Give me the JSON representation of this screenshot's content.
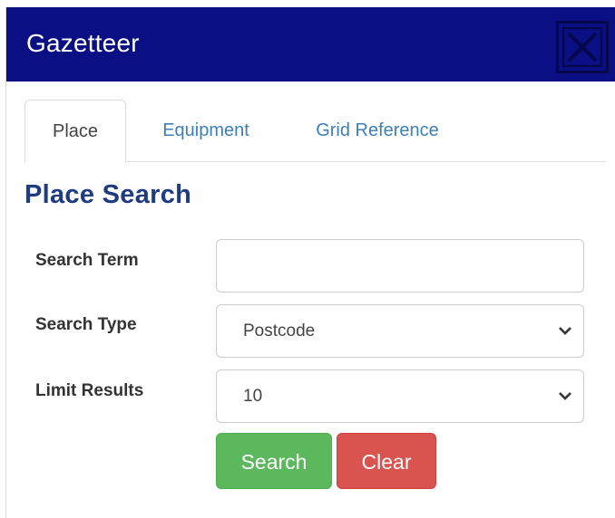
{
  "window": {
    "title": "Gazetteer",
    "close_icon": "close-icon"
  },
  "tabs": [
    {
      "label": "Place",
      "active": true
    },
    {
      "label": "Equipment",
      "active": false
    },
    {
      "label": "Grid Reference",
      "active": false
    }
  ],
  "form": {
    "heading": "Place Search",
    "search_term": {
      "label": "Search Term",
      "value": "",
      "placeholder": ""
    },
    "search_type": {
      "label": "Search Type",
      "selected": "Postcode"
    },
    "limit_results": {
      "label": "Limit Results",
      "selected": "10"
    }
  },
  "buttons": {
    "search": "Search",
    "clear": "Clear"
  },
  "colors": {
    "titlebar": "#0a0f84",
    "heading": "#1f3b82",
    "tab_link": "#3d7fb8",
    "search_button": "#5cb85c",
    "clear_button": "#d9534f"
  }
}
